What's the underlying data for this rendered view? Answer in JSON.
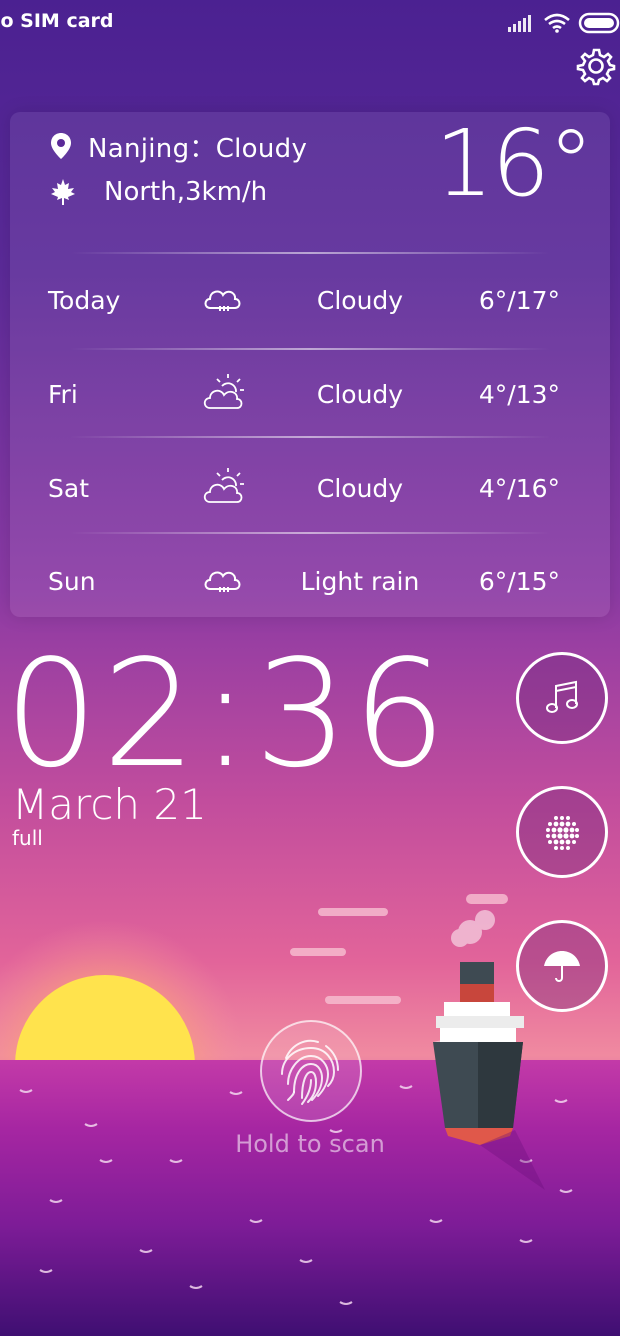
{
  "status_bar": {
    "carrier": "lo SIM card",
    "icons": [
      "signal-icon",
      "wifi-icon",
      "battery-icon"
    ]
  },
  "weather": {
    "location": "Nanjing：Cloudy",
    "wind": "North,3km/h",
    "current_temp": "16°",
    "forecast": [
      {
        "day": "Today",
        "icon": "cloud-rain-icon",
        "condition": "Cloudy",
        "range": "6°/17°"
      },
      {
        "day": "Fri",
        "icon": "partly-cloudy-icon",
        "condition": "Cloudy",
        "range": "4°/13°"
      },
      {
        "day": "Sat",
        "icon": "partly-cloudy-icon",
        "condition": "Cloudy",
        "range": "4°/16°"
      },
      {
        "day": "Sun",
        "icon": "cloud-rain-icon",
        "condition": "Light rain",
        "range": "6°/15°"
      }
    ]
  },
  "clock": {
    "time": "02:36",
    "date": "March 21",
    "sub": "full"
  },
  "shortcuts": [
    "music-icon",
    "dots-icon",
    "umbrella-icon"
  ],
  "fingerprint": {
    "label": "Hold to scan"
  },
  "colors": {
    "sun": "#ffe34d",
    "sea": "#b1239f",
    "ship_hull": "#3e4a52",
    "ship_funnel": "#c8463c"
  }
}
